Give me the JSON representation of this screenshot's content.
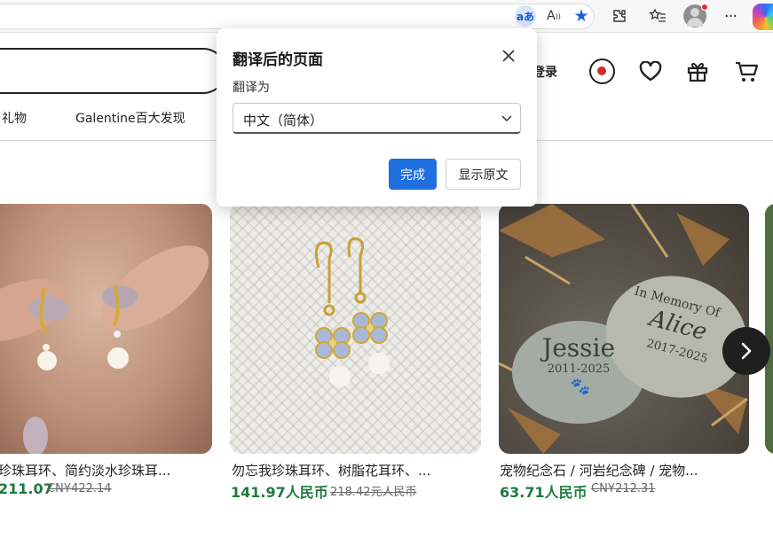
{
  "browser": {
    "translate_icon_text": "aあ",
    "readaloud_icon_text": "A",
    "more_icon_text": "···"
  },
  "header": {
    "signin_label": "登录"
  },
  "nav": {
    "items": [
      {
        "label": "礼物"
      },
      {
        "label": "Galentine百大发现"
      }
    ]
  },
  "products": [
    {
      "title": "珍珠耳环、简约淡水珍珠耳...",
      "price": "211.07",
      "original_price": "CN¥422.14",
      "image": "pearl-hoop-earrings-on-hand"
    },
    {
      "title": "勿忘我珍珠耳环、树脂花耳环、...",
      "price": "141.97人民币",
      "original_price": "218.42元人民币",
      "image": "forget-me-not-pearl-earrings"
    },
    {
      "title": "宠物纪念石 / 河岩纪念碑 / 宠物...",
      "price": "63.71人民币",
      "original_price": "CN¥212.31",
      "image": "engraved-pet-memorial-stones"
    }
  ],
  "stones": {
    "left_name": "Jessie",
    "left_years": "2011-2025",
    "right_line1": "In Memory Of",
    "right_name": "Alice",
    "right_years": "2017-2025"
  },
  "translate_popup": {
    "title": "翻译后的页面",
    "translate_to_label": "翻译为",
    "selected_language": "中文（简体）",
    "done_label": "完成",
    "show_original_label": "显示原文"
  },
  "colors": {
    "accent_blue": "#1f6fe0",
    "price_green": "#1d7a3d",
    "record_red": "#d52a2a"
  }
}
